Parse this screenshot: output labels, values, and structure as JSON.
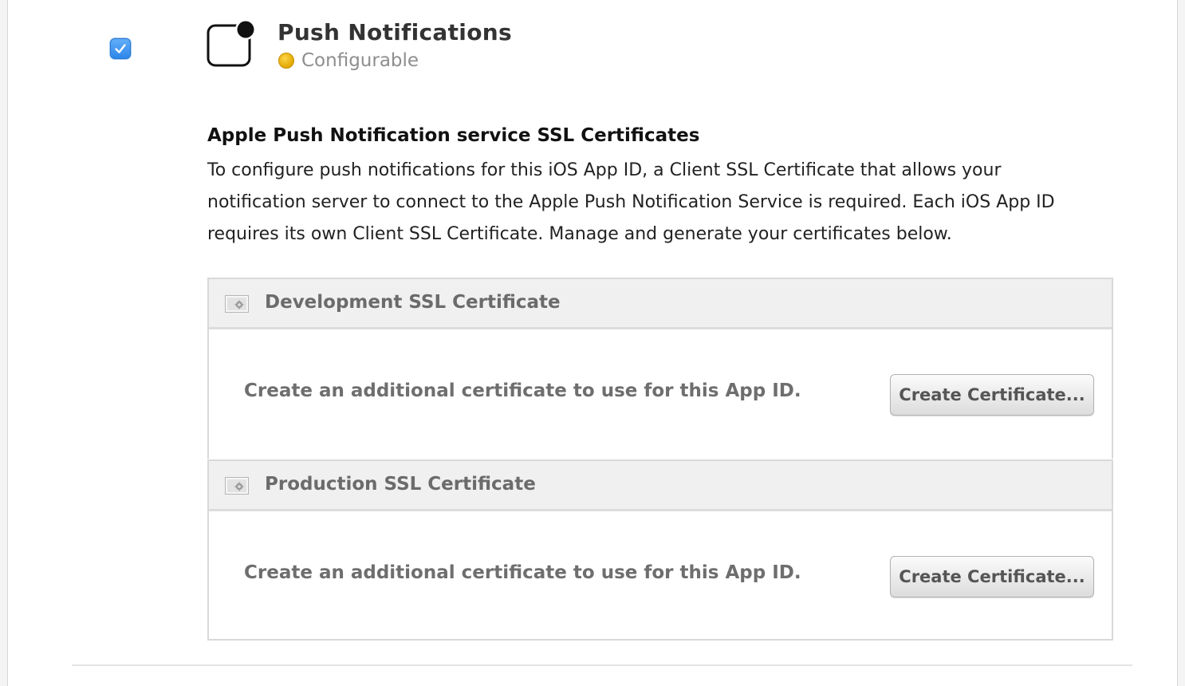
{
  "service": {
    "title": "Push Notifications",
    "status": "Configurable",
    "status_color": "#e7b10a",
    "enabled": true,
    "icon": "notification-badge-icon"
  },
  "section": {
    "heading": "Apple Push Notification service SSL Certificates",
    "description": "To configure push notifications for this iOS App ID, a Client SSL Certificate that allows your notification server to connect to the Apple Push Notification Service is required. Each iOS App ID requires its own Client SSL Certificate. Manage and generate your certificates below."
  },
  "certificates": [
    {
      "title": "Development SSL Certificate",
      "icon": "certificate-icon",
      "message": "Create an additional certificate to use for this App ID.",
      "button_label": "Create Certificate..."
    },
    {
      "title": "Production SSL Certificate",
      "icon": "certificate-icon",
      "message": "Create an additional certificate to use for this App ID.",
      "button_label": "Create Certificate..."
    }
  ],
  "colors": {
    "checkbox": "#3d95ef",
    "header_bg": "#f0f0f0",
    "border": "#d9d9d9"
  }
}
